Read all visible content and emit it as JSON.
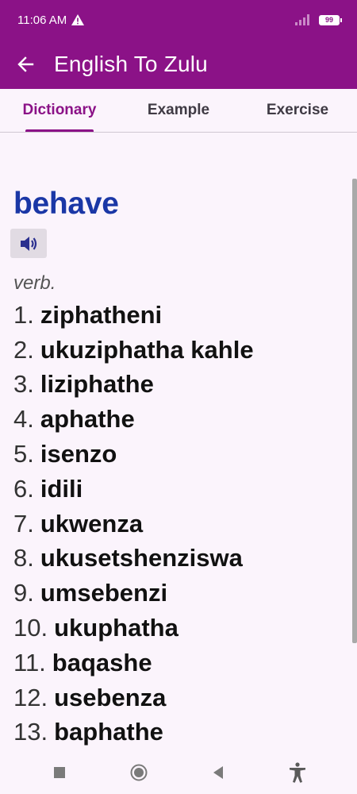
{
  "status_bar": {
    "time": "11:06 AM",
    "battery": "99",
    "icons": [
      "warning-icon",
      "signal-icon",
      "battery-icon"
    ]
  },
  "app_bar": {
    "title": "English To Zulu",
    "back_icon": "arrow-back-icon"
  },
  "tabs": [
    {
      "label": "Dictionary",
      "active": true
    },
    {
      "label": "Example",
      "active": false
    },
    {
      "label": "Exercise",
      "active": false
    }
  ],
  "entry": {
    "word": "behave",
    "speak_icon": "speaker-icon",
    "part_of_speech": "verb.",
    "meanings": [
      {
        "num": "1.",
        "text": "ziphatheni"
      },
      {
        "num": "2.",
        "text": "ukuziphatha kahle"
      },
      {
        "num": "3.",
        "text": "liziphathe"
      },
      {
        "num": "4.",
        "text": "aphathe"
      },
      {
        "num": "5.",
        "text": "isenzo"
      },
      {
        "num": "6.",
        "text": "idili"
      },
      {
        "num": "7.",
        "text": "ukwenza"
      },
      {
        "num": "8.",
        "text": "ukusetshenziswa"
      },
      {
        "num": "9.",
        "text": "umsebenzi"
      },
      {
        "num": "10.",
        "text": "ukuphatha"
      },
      {
        "num": "11.",
        "text": "baqashe"
      },
      {
        "num": "12.",
        "text": "usebenza"
      },
      {
        "num": "13.",
        "text": "baphathe"
      }
    ]
  },
  "nav_bar": {
    "icons": [
      "recents-square-icon",
      "home-circle-icon",
      "back-triangle-icon",
      "accessibility-icon"
    ]
  },
  "colors": {
    "primary": "#8b1287",
    "word": "#1a37a6",
    "background": "#fbf4fc"
  }
}
